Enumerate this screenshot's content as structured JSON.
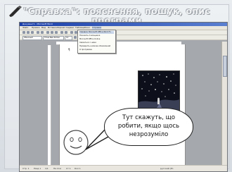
{
  "slide": {
    "title": "\"Справка\": пояснення, пошук, опис програми",
    "speech_text": "Тут скажуть, що робити, якщо щось незрозуміло"
  },
  "word": {
    "title": "Документ1 - Microsoft Word",
    "menu": [
      "Файл",
      "Правка",
      "Вид",
      "Вставка",
      "Формат",
      "Сервис",
      "Таблица",
      "Окно",
      "Справка"
    ],
    "style_combo": "Обычный",
    "font_combo": "Times New Roman",
    "size_combo": "12",
    "help_menu_items": [
      "Справка: Microsoft Office Word   F1",
      "Показать помощника",
      "Microsoft Office Online",
      "Связаться с нами",
      "Проверить наличие обновлений",
      "О программе"
    ],
    "status": [
      "Стр. 1",
      "Разд 1",
      "1/1",
      "На 2см",
      "Ст 1",
      "Кол 1",
      "русский (Ро"
    ]
  },
  "colors": {
    "titlebar": "#1b3fa8",
    "menu_highlight": "#c9d6ea",
    "picture_bg": "#0d0f1a"
  },
  "icons": [
    "pen-icon",
    "smiley-icon"
  ]
}
